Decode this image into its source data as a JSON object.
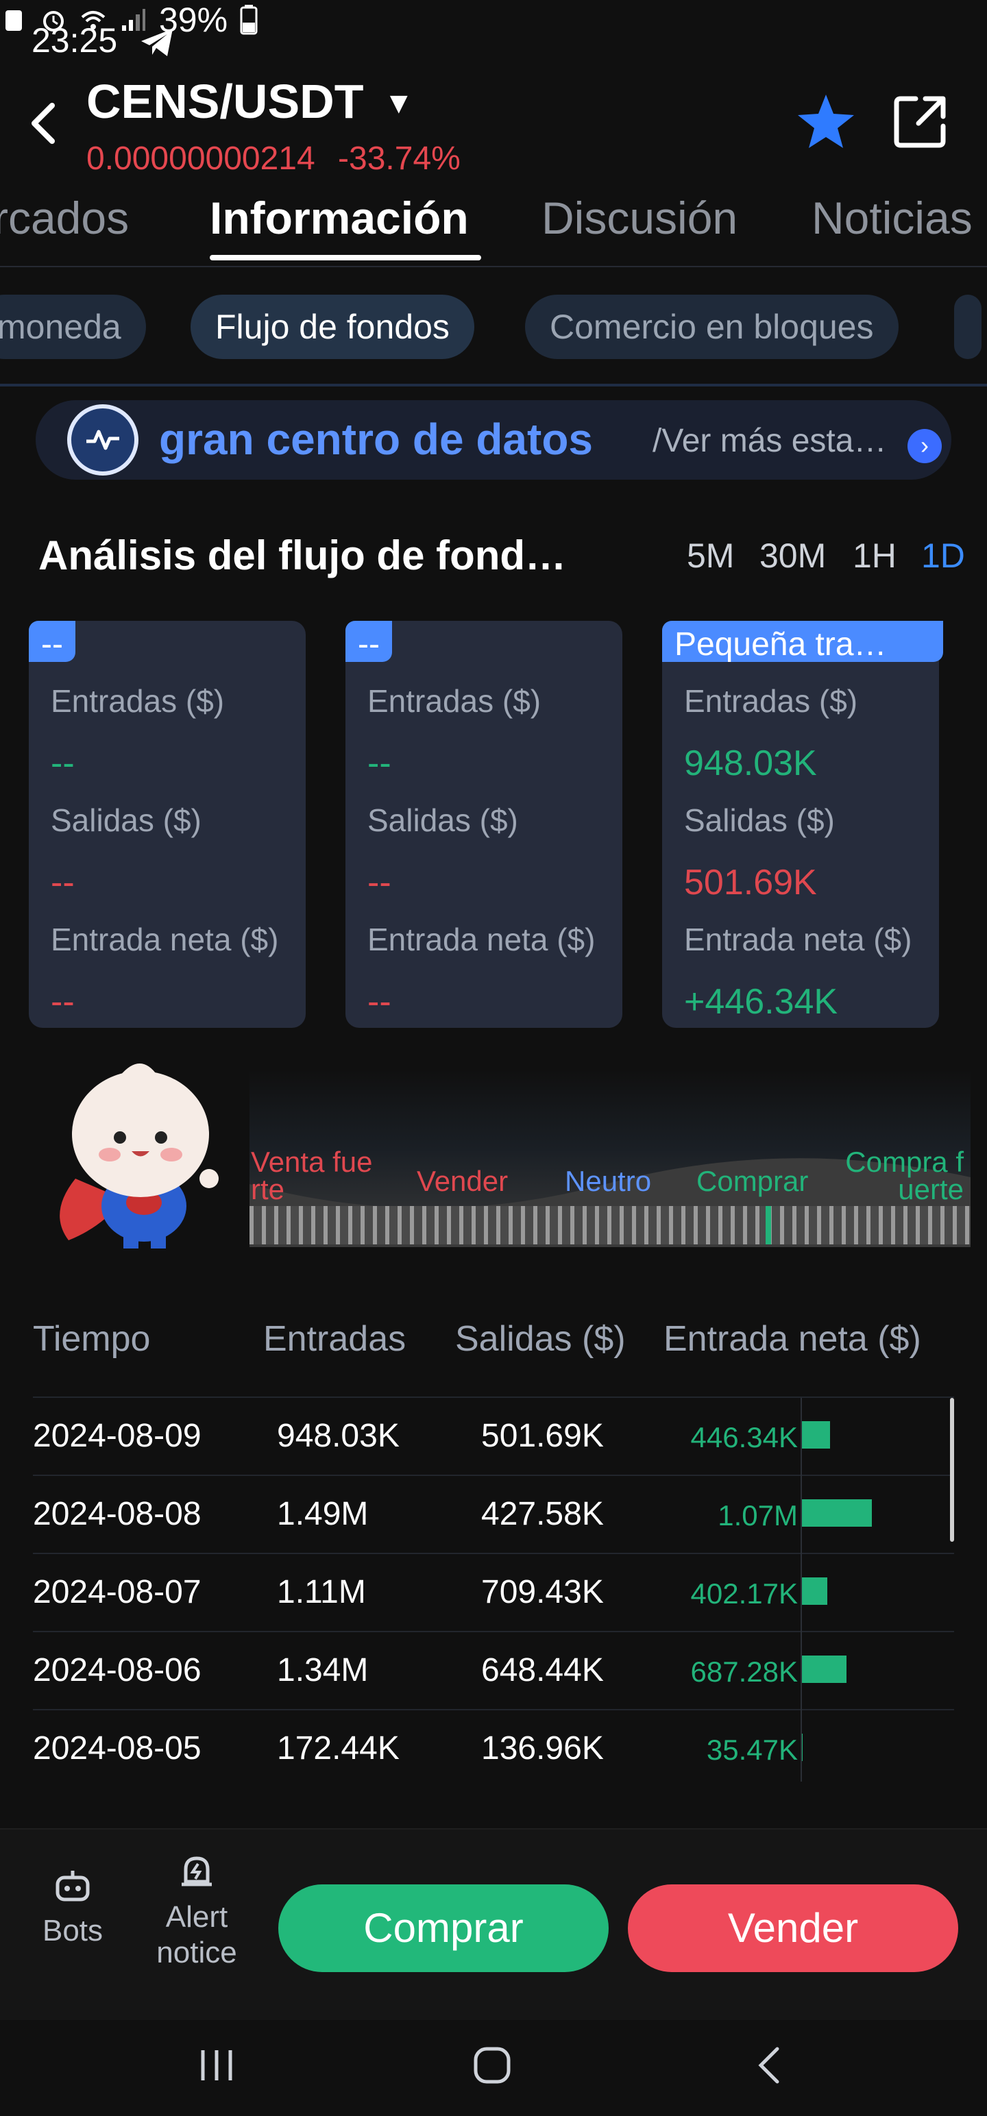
{
  "status": {
    "time": "23:25",
    "battery": "39%"
  },
  "header": {
    "pair": "CENS/USDT",
    "price": "0.00000000214",
    "change": "-33.74%"
  },
  "tabs": [
    "rcados",
    "Información",
    "Discusión",
    "Noticias"
  ],
  "chips": [
    "moneda",
    "Flujo de fondos",
    "Comercio en bloques"
  ],
  "banner": {
    "title": "gran centro de datos",
    "more": "/Ver más estad…"
  },
  "analysis": {
    "title": "Análisis del flujo de fond…",
    "periods": [
      "5M",
      "30M",
      "1H",
      "1D"
    ],
    "labels": {
      "in": "Entradas ($)",
      "out": "Salidas ($)",
      "net": "Entrada neta ($)"
    },
    "cards": [
      {
        "tag": "--",
        "in": "--",
        "out": "--",
        "net": "--"
      },
      {
        "tag": "--",
        "in": "--",
        "out": "--",
        "net": "--"
      },
      {
        "tag": "Pequeña tra…",
        "in": "948.03K",
        "out": "501.69K",
        "net": "+446.34K"
      }
    ]
  },
  "sentiment": {
    "strong_sell": "Venta fue rte",
    "sell": "Vender",
    "neutral": "Neutro",
    "buy": "Comprar",
    "strong_buy": "Compra f uerte",
    "level": 0.72
  },
  "table": {
    "headers": [
      "Tiempo",
      "Entradas",
      "Salidas ($)",
      "Entrada neta ($)"
    ],
    "rows": [
      {
        "date": "2024-08-09",
        "in": "948.03K",
        "out": "501.69K",
        "net": "446.34K",
        "net_value": 446.34
      },
      {
        "date": "2024-08-08",
        "in": "1.49M",
        "out": "427.58K",
        "net": "1.07M",
        "net_value": 1070
      },
      {
        "date": "2024-08-07",
        "in": "1.11M",
        "out": "709.43K",
        "net": "402.17K",
        "net_value": 402.17
      },
      {
        "date": "2024-08-06",
        "in": "1.34M",
        "out": "648.44K",
        "net": "687.28K",
        "net_value": 687.28
      },
      {
        "date": "2024-08-05",
        "in": "172.44K",
        "out": "136.96K",
        "net": "35.47K",
        "net_value": 35.47
      }
    ]
  },
  "bottom": {
    "bots": "Bots",
    "alert": "Alert notice",
    "buy": "Comprar",
    "sell": "Vender"
  },
  "colors": {
    "green": "#22b37a",
    "red": "#e0484f",
    "accent": "#3b8cff",
    "buy_button": "#22b87a",
    "sell_button": "#ee4a5a"
  }
}
